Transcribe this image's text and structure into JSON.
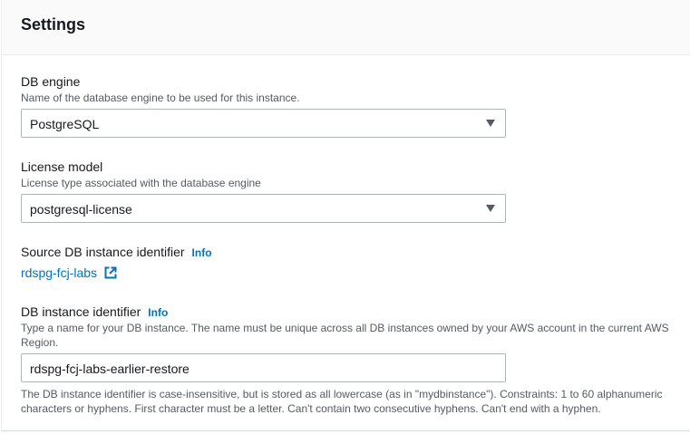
{
  "settings": {
    "title": "Settings",
    "db_engine": {
      "label": "DB engine",
      "description": "Name of the database engine to be used for this instance.",
      "value": "PostgreSQL"
    },
    "license_model": {
      "label": "License model",
      "description": "License type associated with the database engine",
      "value": "postgresql-license"
    },
    "source_identifier": {
      "label": "Source DB instance identifier",
      "info": "Info",
      "link_text": "rdspg-fcj-labs"
    },
    "db_instance_identifier": {
      "label": "DB instance identifier",
      "info": "Info",
      "description_line1": "Type a name for your DB instance. The name must be unique across all DB instances owned by your AWS account in the current AWS",
      "description_line2": "Region.",
      "value": "rdspg-fcj-labs-earlier-restore",
      "constraint_line1": "The DB instance identifier is case-insensitive, but is stored as all lowercase (as in \"mydbinstance\"). Constraints: 1 to 60 alphanumeric",
      "constraint_line2": "characters or hyphens. First character must be a letter. Can't contain two consecutive hyphens. Can't end with a hyphen."
    }
  },
  "icons": {
    "dropdown": "caret-down-icon",
    "external_link": "external-link-icon"
  },
  "colors": {
    "link": "#0073bb",
    "text": "#16191f",
    "secondary_text": "#545b64",
    "border": "#aab7b8",
    "header_bg": "#fafafa"
  }
}
